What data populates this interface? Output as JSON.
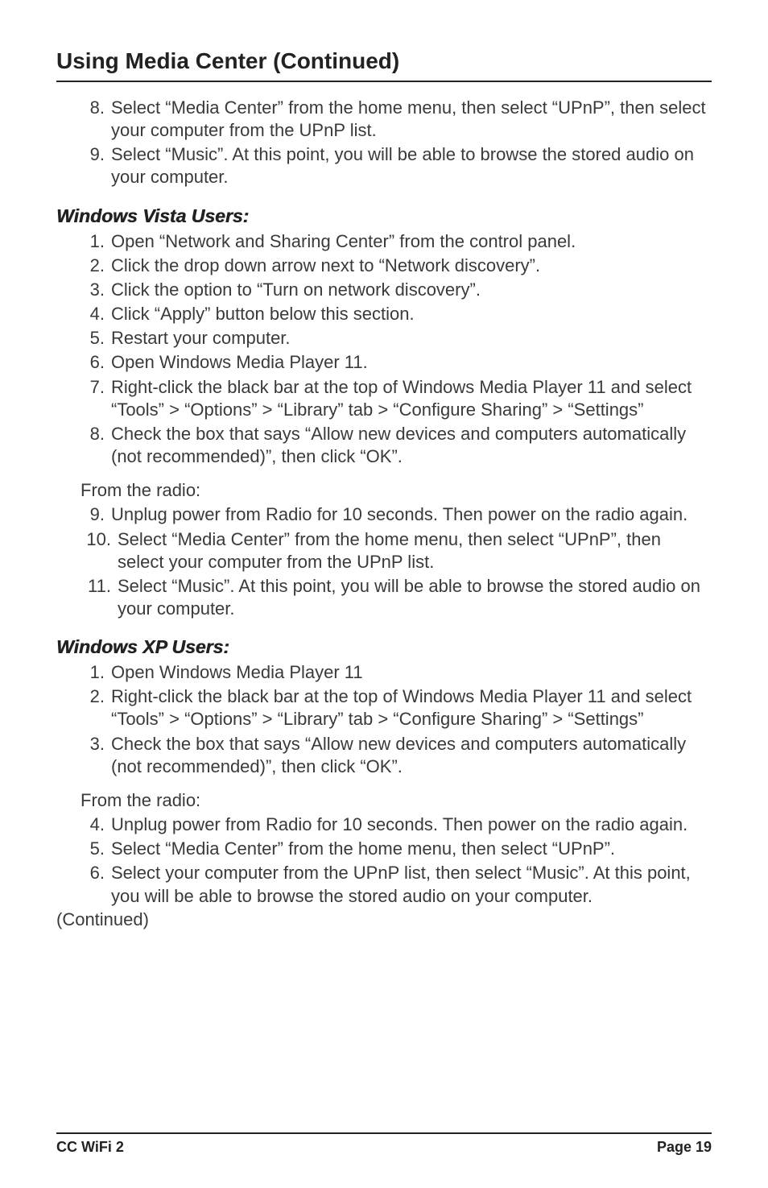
{
  "heading": "Using Media Center (Continued)",
  "topList": [
    {
      "n": "8.",
      "t": "Select “Media Center” from the home menu, then select “UPnP”, then select your computer from the UPnP list."
    },
    {
      "n": "9.",
      "t": "Select “Music”. At this point, you will be able to browse the stored audio on your computer."
    }
  ],
  "vistaHeading": "Windows Vista Users:",
  "vistaListA": [
    {
      "n": "1.",
      "t": "Open “Network and Sharing Center” from the control panel."
    },
    {
      "n": "2.",
      "t": "Click the drop down arrow next to “Network discovery”."
    },
    {
      "n": "3.",
      "t": "Click the option to “Turn on network discovery”."
    },
    {
      "n": "4.",
      "t": "Click “Apply” button below this section."
    },
    {
      "n": "5.",
      "t": "Restart your computer."
    },
    {
      "n": "6.",
      "t": "Open Windows Media Player 11."
    },
    {
      "n": "7.",
      "t": "Right-click the black bar at the top of Windows Media Player 11 and select “Tools” > “Options” > “Library” tab > “Configure Sharing” > “Settings”"
    },
    {
      "n": "8.",
      "t": "Check the box that says “Allow new devices and computers automatically (not recommended)”, then click “OK”."
    }
  ],
  "fromRadio": "From the radio:",
  "vistaListB": [
    {
      "n": "9.",
      "t": "Unplug power from Radio for 10 seconds. Then power on the radio again."
    },
    {
      "n": "10.",
      "t": "Select “Media Center” from the home menu, then select “UPnP”, then select your computer from the UPnP list."
    },
    {
      "n": "11.",
      "t": "Select “Music”. At this point, you will be able to browse the stored audio on your computer."
    }
  ],
  "xpHeading": "Windows XP Users:",
  "xpListA": [
    {
      "n": "1.",
      "t": "Open Windows Media Player 11"
    },
    {
      "n": "2.",
      "t": "Right-click the black bar at the top of Windows Media Player 11 and select “Tools” > “Options” > “Library” tab > “Configure Sharing” > “Settings”"
    },
    {
      "n": "3.",
      "t": "Check the box that says “Allow new devices and computers automatically (not recommended)”, then click “OK”."
    }
  ],
  "xpListB": [
    {
      "n": "4.",
      "t": "Unplug power from Radio for 10 seconds. Then power on the radio again."
    },
    {
      "n": "5.",
      "t": "Select “Media Center” from the home menu, then select “UPnP”."
    },
    {
      "n": "6.",
      "t": "Select your computer from the UPnP list, then select “Music”. At this point, you will be able to browse the stored audio on your computer."
    }
  ],
  "continued": "(Continued)",
  "footerLeft": "CC WiFi 2",
  "footerRight": "Page 19"
}
